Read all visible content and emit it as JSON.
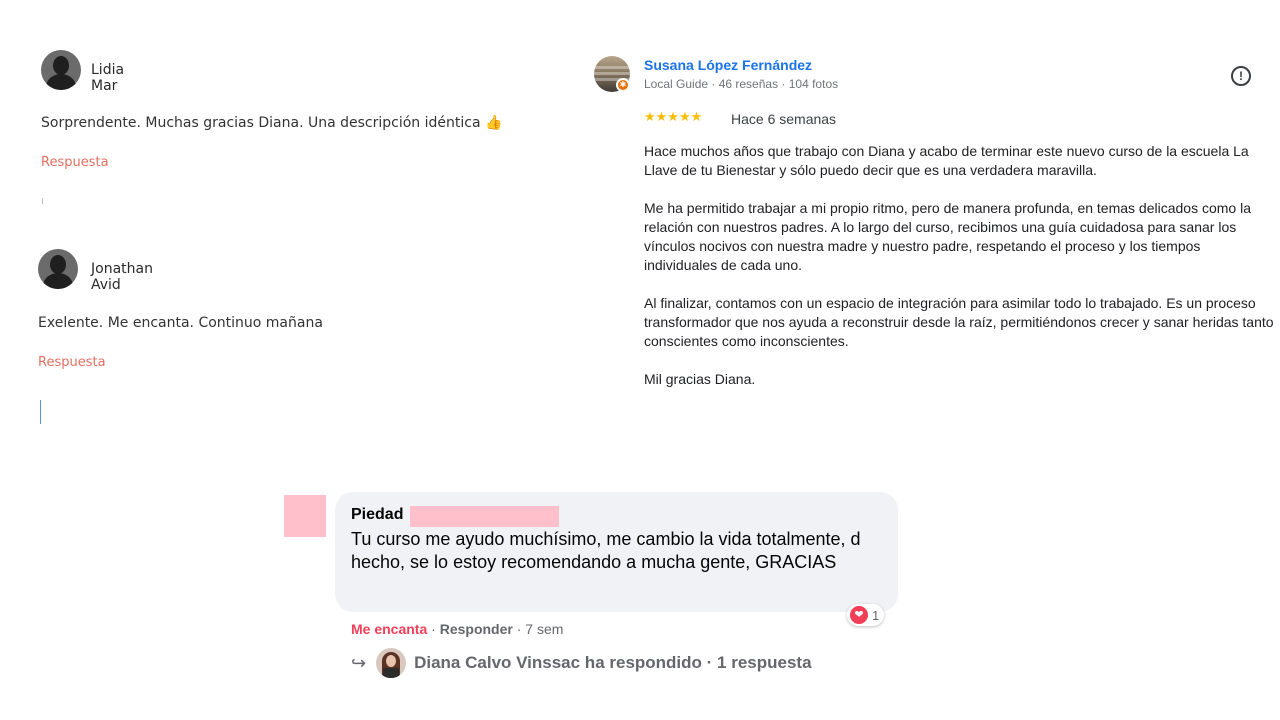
{
  "left_comments": [
    {
      "name": "Lidia Mar",
      "text": "Sorprendente. Muchas gracias Diana. Una descripción idéntica 👍",
      "reply_label": "Respuesta"
    },
    {
      "name": "Jonathan Avid",
      "text": "Exelente. Me encanta. Continuo mañana",
      "reply_label": "Respuesta"
    }
  ],
  "google_review": {
    "author": "Susana López Fernández",
    "meta": "Local Guide · 46 reseñas · 104 fotos",
    "stars": "★★★★★",
    "rating": 5,
    "date": "Hace 6 semanas",
    "flag_icon": "!",
    "paragraphs": [
      "Hace muchos años que trabajo con Diana y acabo de terminar este nuevo curso de la escuela La Llave de tu Bienestar y sólo puedo decir que es una verdadera maravilla.",
      "Me ha permitido trabajar a mi propio ritmo, pero de manera profunda, en temas delicados como la relación con nuestros padres. A lo largo del curso, recibimos una guía cuidadosa para sanar los vínculos nocivos con nuestra madre y nuestro padre, respetando el proceso y los tiempos individuales de cada uno.",
      "Al finalizar, contamos con un espacio de integración para asimilar todo lo trabajado. Es un proceso transformador que nos ayuda a reconstruir desde la raíz, permitiéndonos crecer y sanar heridas tanto conscientes como inconscientes.",
      "Mil gracias Diana."
    ],
    "colors": {
      "name": "#1a73e8",
      "stars": "#fbbc04"
    }
  },
  "facebook_comment": {
    "name": "Piedad",
    "text": "Tu curso me ayudo muchísimo, me cambio la vida totalmente, d hecho, se lo estoy recomendando a mucha gente, GRACIAS",
    "reaction_count": "1",
    "reaction_icon": "heart-icon",
    "action_love": "Me encanta",
    "action_sep": " · ",
    "action_reply": "Responder",
    "time": " · 7 sem",
    "reply_arrow": "↪",
    "reply_summary": "Diana Calvo Vinssac ha respondido · 1 respuesta",
    "colors": {
      "love": "#f33e58",
      "bubble": "#f0f2f5"
    }
  }
}
